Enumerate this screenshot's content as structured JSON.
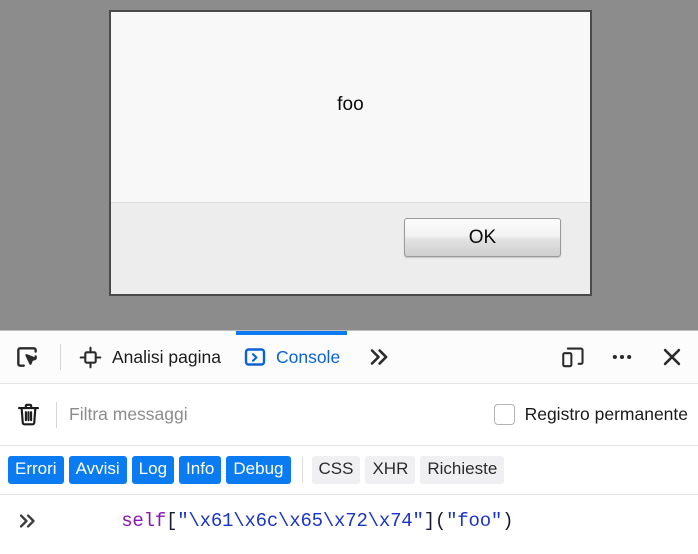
{
  "dialog": {
    "message": "foo",
    "ok_label": "OK",
    "backdrop_color": "#8c8c8c",
    "border_color": "#4a4a4a"
  },
  "devtools": {
    "toolbar": {
      "pick_element_icon": "pick-element-icon",
      "page_inspector_icon": "page-inspector-icon",
      "console_icon": "console-prompt-icon",
      "more_tabs_icon": "chevron-double-right-icon",
      "responsive_mode_icon": "responsive-design-mode-icon",
      "meatball_icon": "more-options-icon",
      "close_icon": "close-icon",
      "tabs": [
        {
          "id": "inspector",
          "label": "Analisi pagina",
          "active": false
        },
        {
          "id": "console",
          "label": "Console",
          "active": true
        }
      ],
      "active_tab_color": "#0a7bf0"
    },
    "filter_bar": {
      "clear_icon": "trash-icon",
      "filter_placeholder": "Filtra messaggi",
      "filter_value": "",
      "persist_logs_label": "Registro permanente",
      "persist_logs_checked": false
    },
    "filter_pills": {
      "severity": [
        {
          "label": "Errori",
          "active": true
        },
        {
          "label": "Avvisi",
          "active": true
        },
        {
          "label": "Log",
          "active": true
        },
        {
          "label": "Info",
          "active": true
        },
        {
          "label": "Debug",
          "active": true
        }
      ],
      "categories": [
        {
          "label": "CSS",
          "active": false
        },
        {
          "label": "XHR",
          "active": false
        },
        {
          "label": "Richieste",
          "active": false
        }
      ],
      "active_color": "#0a7bf0",
      "inactive_color": "#f0f0f2"
    },
    "console_input": {
      "prompt": "»",
      "tokens": [
        {
          "text": "self",
          "type": "keyword"
        },
        {
          "text": "[",
          "type": "punctuation"
        },
        {
          "text": "\"\\x61\\x6c\\x65\\x72\\x74\"",
          "type": "string"
        },
        {
          "text": "]",
          "type": "punctuation"
        },
        {
          "text": "(",
          "type": "punctuation"
        },
        {
          "text": "\"foo\"",
          "type": "string"
        },
        {
          "text": ")",
          "type": "punctuation"
        }
      ],
      "full_text": "self[\"\\x61\\x6c\\x65\\x72\\x74\"](\"foo\")"
    }
  }
}
